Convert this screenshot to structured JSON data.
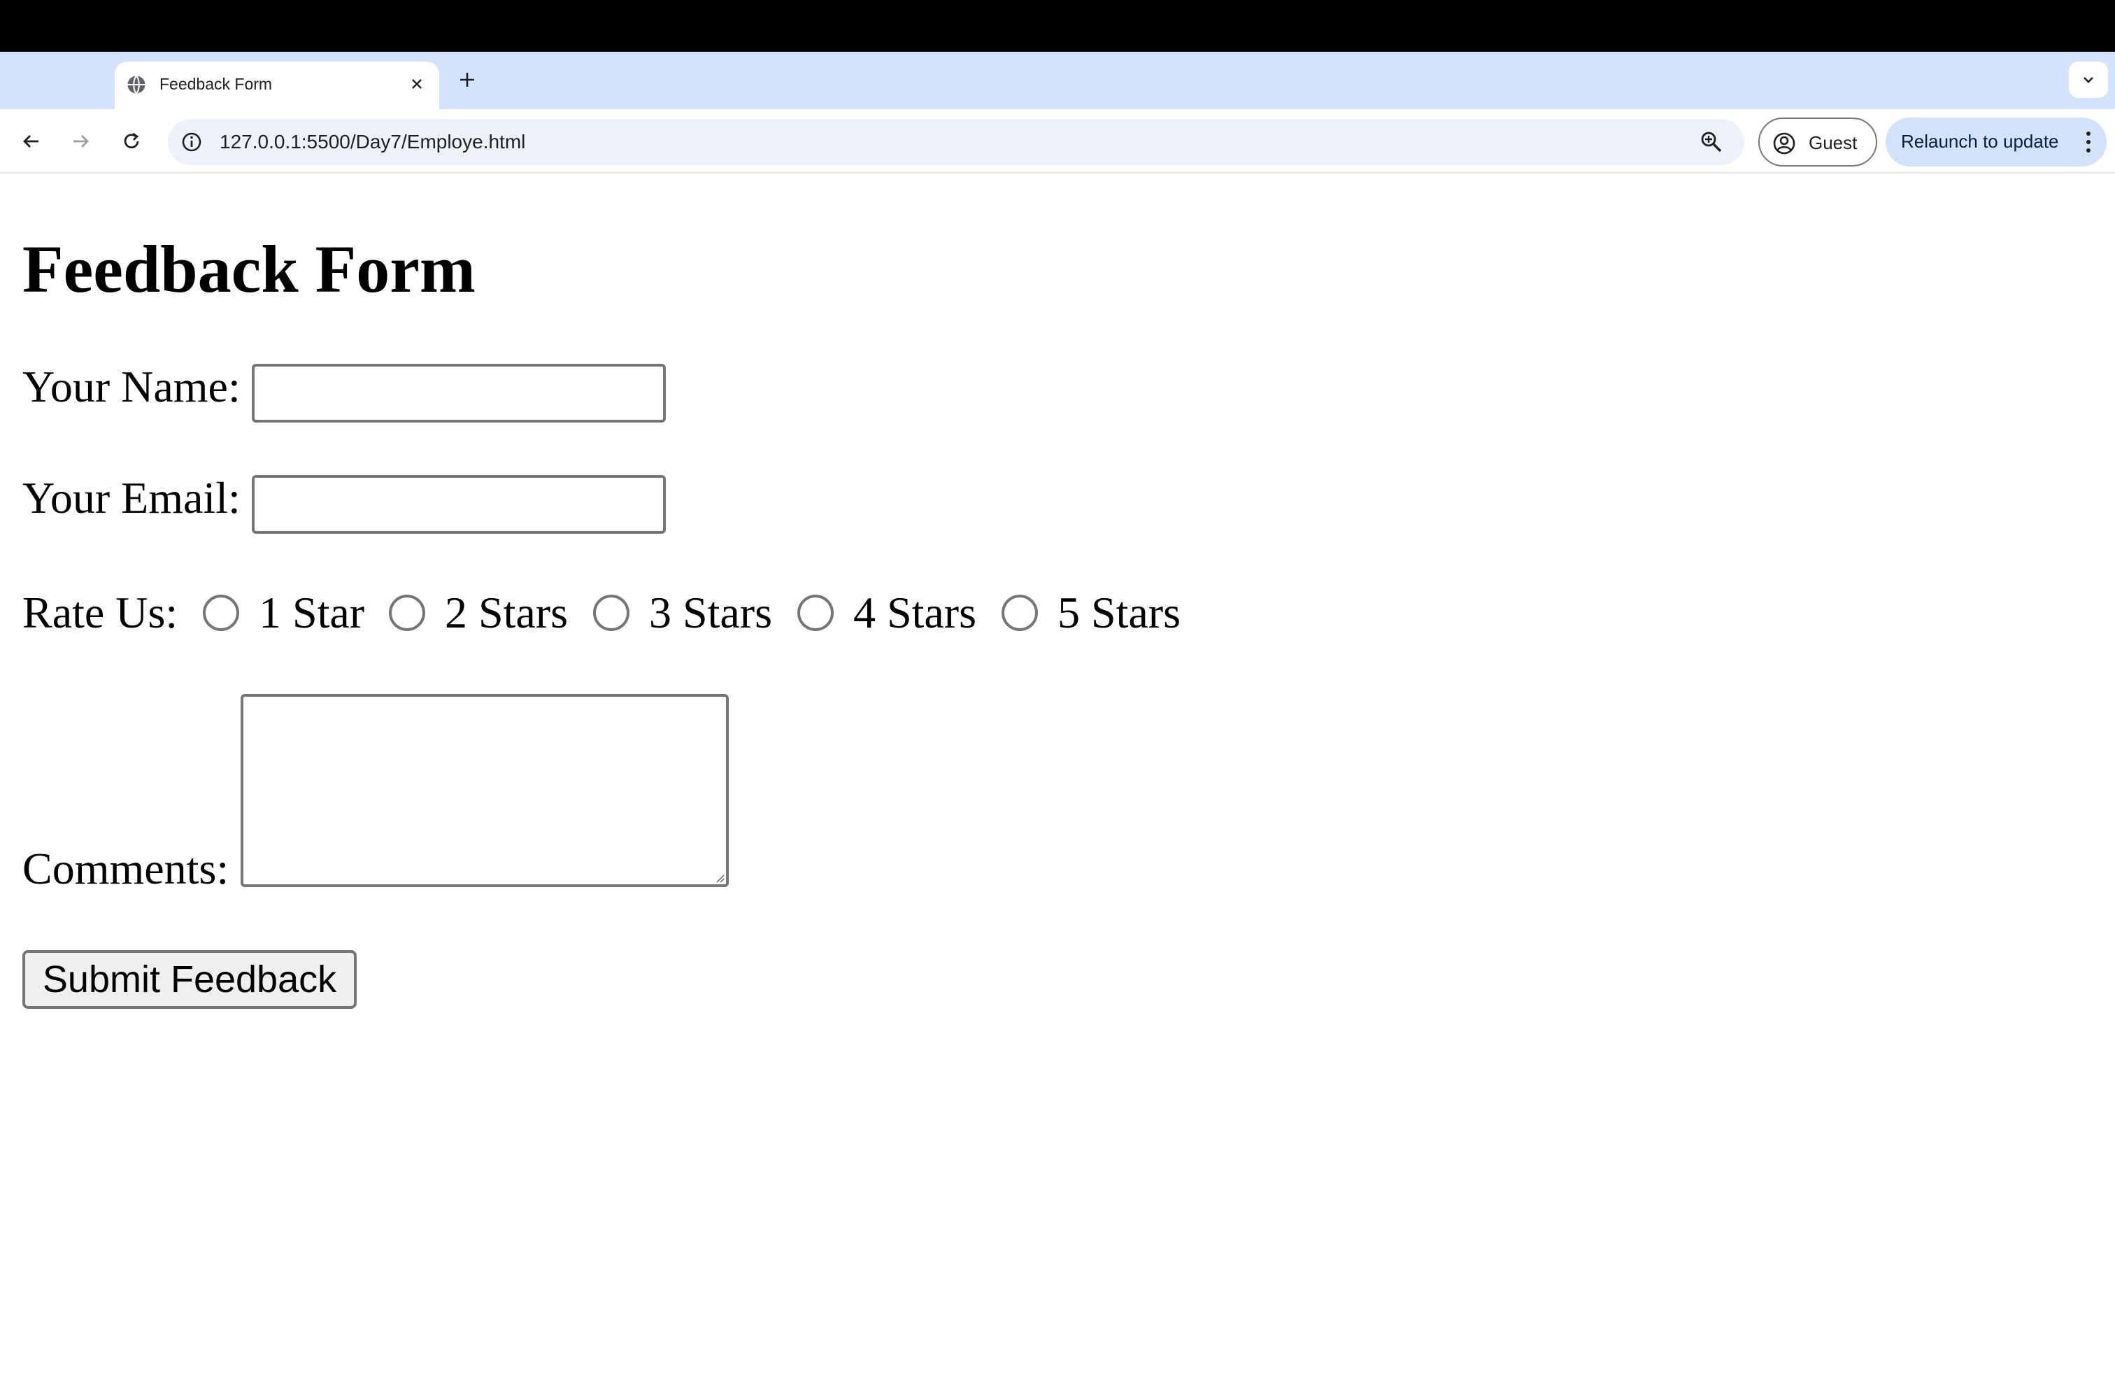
{
  "browser": {
    "tab": {
      "title": "Feedback Form",
      "favicon": "globe-icon",
      "close_icon": "close-icon"
    },
    "new_tab_icon": "plus-icon",
    "tab_search_icon": "chevron-down-icon",
    "nav": {
      "back_icon": "arrow-left-icon",
      "forward_icon": "arrow-right-icon",
      "reload_icon": "reload-icon"
    },
    "omnibox": {
      "url": "127.0.0.1:5500/Day7/Employe.html",
      "info_icon": "info-icon",
      "zoom_icon": "zoom-icon"
    },
    "profile": {
      "label": "Guest",
      "icon": "account-circle-icon"
    },
    "relaunch": {
      "label": "Relaunch to update",
      "menu_icon": "more-vert-icon"
    },
    "colors": {
      "tabstrip": "#d3e3fd",
      "omnibox": "#edf2fa",
      "relaunch": "#d3e3fd"
    }
  },
  "form": {
    "title": "Feedback Form",
    "name_label": "Your Name:",
    "name_value": "",
    "email_label": "Your Email:",
    "email_value": "",
    "rate_label": "Rate Us:",
    "rating_options": [
      "1 Star",
      "2 Stars",
      "3 Stars",
      "4 Stars",
      "5 Stars"
    ],
    "selected_rating": null,
    "comments_label": "Comments:",
    "comments_value": "",
    "submit_label": "Submit Feedback"
  }
}
